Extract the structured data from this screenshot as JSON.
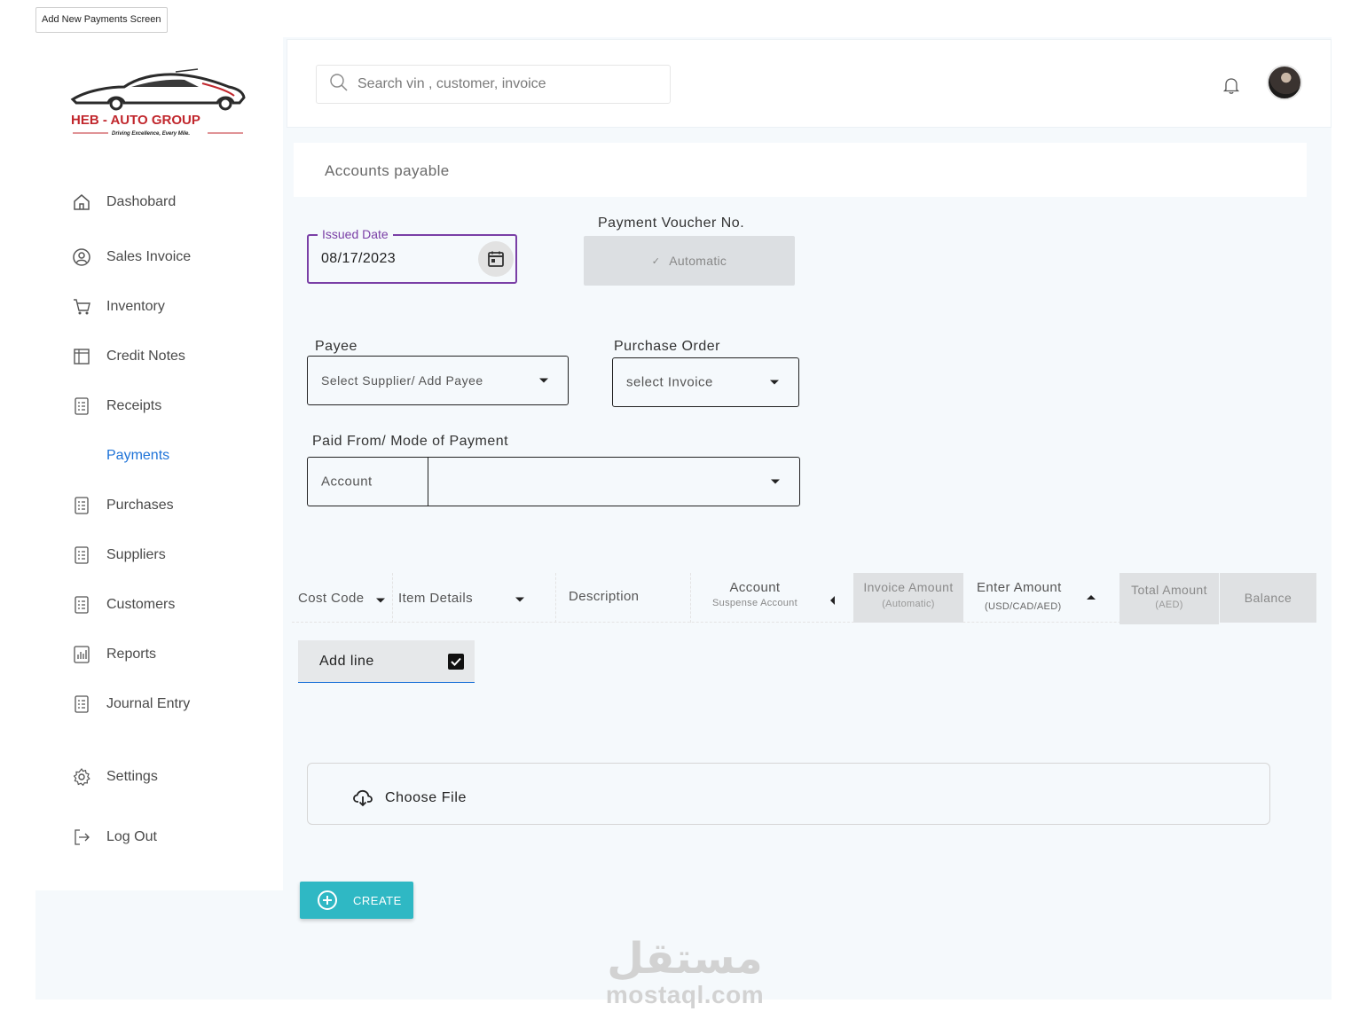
{
  "frame_label": "Add New Payments Screen",
  "brand": {
    "name": "HEB - AUTO GROUP",
    "tagline": "Driving Excellence, Every Mile."
  },
  "search": {
    "placeholder": "Search vin , customer, invoice"
  },
  "sidebar": {
    "items": [
      {
        "label": "Dashobard",
        "icon": "home-icon"
      },
      {
        "label": "Sales Invoice",
        "icon": "user-circle-icon"
      },
      {
        "label": "Inventory",
        "icon": "cart-icon"
      },
      {
        "label": "Credit Notes",
        "icon": "notes-icon"
      },
      {
        "label": "Receipts",
        "icon": "list-icon"
      },
      {
        "label": "Payments",
        "icon": "list-icon",
        "active": true
      },
      {
        "label": "Purchases",
        "icon": "list-icon"
      },
      {
        "label": "Suppliers",
        "icon": "list-icon"
      },
      {
        "label": "Customers",
        "icon": "list-icon"
      },
      {
        "label": "Reports",
        "icon": "chart-icon"
      },
      {
        "label": "Journal Entry",
        "icon": "list-icon"
      },
      {
        "label": "Settings",
        "icon": "gear-icon"
      },
      {
        "label": "Log Out",
        "icon": "logout-icon"
      }
    ]
  },
  "page": {
    "title": "Accounts payable"
  },
  "form": {
    "issued_date": {
      "label": "Issued Date",
      "value": "08/17/2023"
    },
    "voucher": {
      "label": "Payment Voucher No.",
      "value": "Automatic"
    },
    "payee": {
      "label": "Payee",
      "value": "Select  Supplier/ Add  Payee"
    },
    "purchase_order": {
      "label": "Purchase Order",
      "value": "select Invoice"
    },
    "paid_from": {
      "label": "Paid From/ Mode of Payment",
      "account_label": "Account",
      "value": ""
    }
  },
  "table": {
    "columns": {
      "cost_code": "Cost Code",
      "item_details": "Item Details",
      "description": "Description",
      "account": "Account",
      "account_sub": "Suspense Account",
      "invoice_amount": "Invoice Amount",
      "invoice_amount_sub": "(Automatic)",
      "enter_amount": "Enter Amount",
      "enter_amount_sub": "(USD/CAD/AED)",
      "total_amount": "Total Amount",
      "total_amount_sub": "(AED)",
      "balance": "Balance"
    },
    "add_line": "Add line"
  },
  "upload": {
    "label": "Choose File"
  },
  "create_button": "CREATE",
  "watermark": {
    "arabic": "مستقل",
    "latin": "mostaql.com"
  },
  "colors": {
    "accent": "#1e73d8",
    "date_border": "#7a3fa6",
    "create": "#2fb8c4"
  }
}
